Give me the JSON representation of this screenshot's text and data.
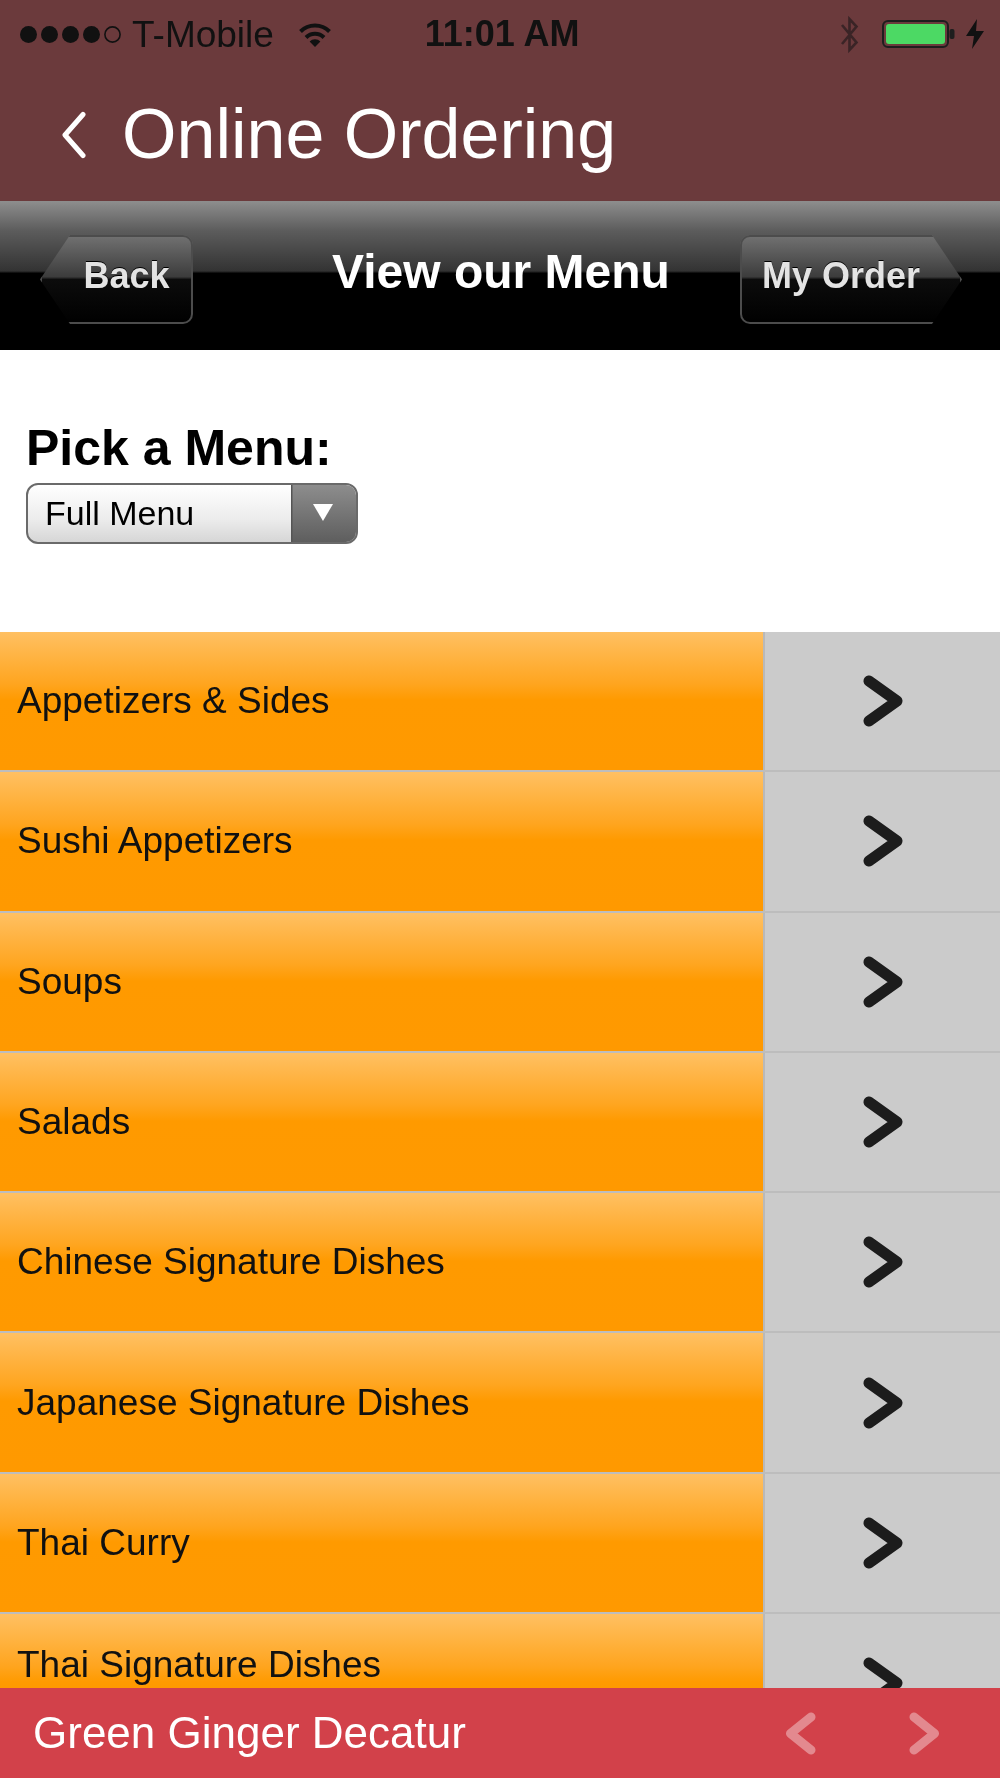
{
  "status_bar": {
    "carrier": "T-Mobile",
    "time": "11:01 AM"
  },
  "header": {
    "title": "Online Ordering"
  },
  "toolbar": {
    "back_button": "Back",
    "title": "View our Menu",
    "order_button": "My Order"
  },
  "menu_picker": {
    "label": "Pick a Menu:",
    "value": "Full Menu"
  },
  "categories": [
    {
      "label": "Appetizers & Sides"
    },
    {
      "label": "Sushi Appetizers"
    },
    {
      "label": "Soups"
    },
    {
      "label": "Salads"
    },
    {
      "label": "Chinese Signature Dishes"
    },
    {
      "label": "Japanese Signature Dishes"
    },
    {
      "label": "Thai Curry"
    },
    {
      "label": "Thai Signature Dishes"
    }
  ],
  "footer": {
    "title": "Green Ginger Decatur",
    "nav": [
      {
        "kind": "previous",
        "disabled": true
      },
      {
        "kind": "next",
        "disabled": true
      }
    ]
  }
}
